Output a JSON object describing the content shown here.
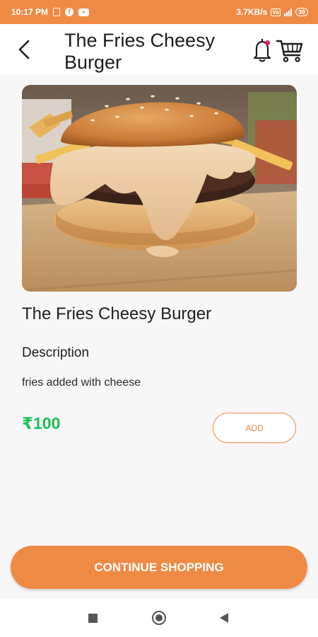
{
  "status_bar": {
    "time": "10:17 PM",
    "fb_glyph": "f",
    "net_speed": "3.7KB/s",
    "volte": "Vo",
    "battery": "39"
  },
  "header": {
    "title": "The Fries Cheesy Burger"
  },
  "product": {
    "image_icon": "burger-photo",
    "name": "The Fries Cheesy Burger",
    "description_heading": "Description",
    "description": "fries added with cheese",
    "price": "₹100",
    "add_label": "ADD"
  },
  "footer": {
    "continue_label": "CONTINUE SHOPPING"
  },
  "colors": {
    "accent": "#ef8a45",
    "price": "#1dbf55",
    "notification_dot": "#e5195c"
  }
}
